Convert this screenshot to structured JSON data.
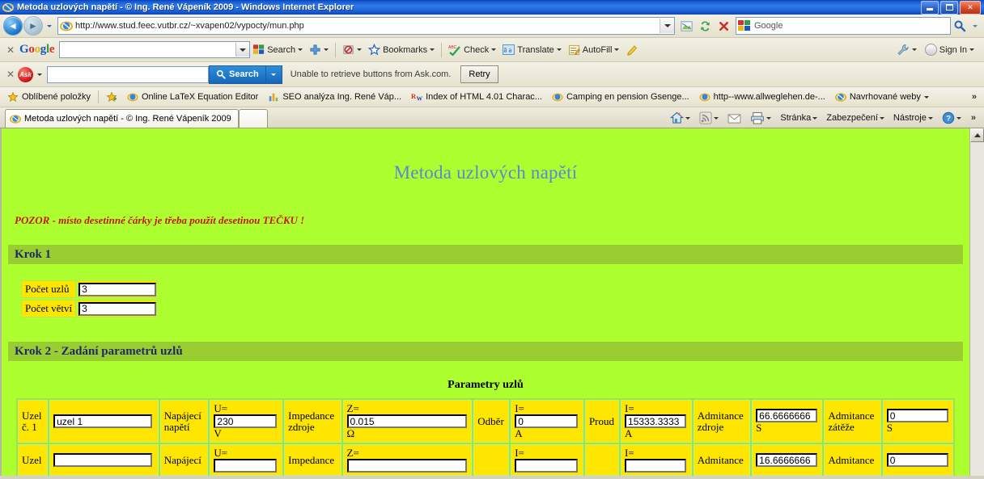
{
  "window": {
    "title": "Metoda uzlových napětí - © Ing. René Vápeník 2009 - Windows Internet Explorer",
    "minimize_label": "Minimize",
    "maximize_label": "Maximize",
    "close_label": "✕"
  },
  "navbar": {
    "back_glyph": "◄",
    "forward_glyph": "►",
    "url": "http://www.stud.feec.vutbr.cz/~xvapen02/vypocty/mun.php",
    "search_placeholder": "Google",
    "search_value": ""
  },
  "google_toolbar": {
    "close_x": "✕",
    "logo": [
      "G",
      "o",
      "o",
      "g",
      "l",
      "e"
    ],
    "input_value": "",
    "items": [
      {
        "label": "Search",
        "icon": "google-colors-icon",
        "caret": true
      },
      {
        "label": "",
        "icon": "plus-icon",
        "caret": true
      },
      {
        "label": "",
        "icon": "blocked-popup-icon",
        "caret": true
      },
      {
        "label": "Bookmarks",
        "icon": "star-icon",
        "caret": true
      },
      {
        "label": "Check",
        "icon": "spellcheck-icon",
        "caret": true
      },
      {
        "label": "Translate",
        "icon": "translate-icon",
        "caret": true
      },
      {
        "label": "AutoFill",
        "icon": "autofill-icon",
        "caret": true
      },
      {
        "label": "",
        "icon": "highlighter-icon",
        "caret": false
      }
    ],
    "right": [
      {
        "label": "",
        "icon": "wrench-icon",
        "caret": true
      },
      {
        "label": "Sign In",
        "icon": "user-circle-icon",
        "caret": true
      }
    ]
  },
  "ask_toolbar": {
    "close_x": "✕",
    "logo": "Ask",
    "input_value": "",
    "search_label": "Search",
    "message": "Unable to retrieve buttons from Ask.com.",
    "retry_label": "Retry"
  },
  "favorites": {
    "root_label": "Oblíbené položky",
    "items": [
      {
        "label": "Online LaTeX Equation Editor",
        "icon": "ie-page-icon"
      },
      {
        "label": "SEO analýza Ing. René Váp...",
        "icon": "chart-icon"
      },
      {
        "label": "Index of HTML 4.01 Charac...",
        "icon": "rw-icon"
      },
      {
        "label": "Camping en pension Gsenge...",
        "icon": "ie-page-icon"
      },
      {
        "label": "http--www.allweglehen.de-...",
        "icon": "ie-page-icon"
      },
      {
        "label": "Navrhované weby",
        "icon": "ie-logo-icon",
        "caret": true
      }
    ],
    "overflow": "»"
  },
  "tabs": {
    "open": [
      {
        "label": "Metoda uzlových napětí - © Ing. René Vápeník 2009",
        "icon": "ie-logo-icon",
        "active": true
      }
    ],
    "new_tab_label": "",
    "commands": [
      {
        "label": "",
        "icon": "home-icon",
        "caret": true
      },
      {
        "label": "",
        "icon": "rss-icon",
        "caret": true
      },
      {
        "label": "",
        "icon": "mail-icon",
        "caret": false
      },
      {
        "label": "",
        "icon": "print-icon",
        "caret": true
      },
      {
        "label": "Stránka",
        "icon": "",
        "caret": true
      },
      {
        "label": "Zabezpečení",
        "icon": "",
        "caret": true
      },
      {
        "label": "Nástroje",
        "icon": "",
        "caret": true
      },
      {
        "label": "",
        "icon": "help-icon",
        "caret": true
      }
    ],
    "overflow": "»"
  },
  "page": {
    "title": "Metoda uzlových napětí",
    "warning": "POZOR - místo desetinné čárky je třeba použít desetinou TEČKU !",
    "step1": {
      "heading": "Krok 1",
      "fields": [
        {
          "label": "Počet uzlů",
          "value": "3"
        },
        {
          "label": "Počet větví",
          "value": "3"
        }
      ]
    },
    "step2": {
      "heading": "Krok 2 - Zadání parametrů uzlů",
      "table_caption": "Parametry uzlů",
      "rows": [
        {
          "node_label": "Uzel\nč. 1",
          "name_value": "uzel 1",
          "supply_label": "Napájecí napětí",
          "u_prefix": "U=",
          "u_value": "230",
          "u_unit": "V",
          "impedance_label": "Impedance zdroje",
          "z_prefix": "Z=",
          "z_value": "0.015",
          "z_unit": "Ω",
          "draw_label": "Odběr",
          "i_prefix": "I=",
          "i_value": "0",
          "i_unit": "A",
          "current_label": "Proud",
          "i2_prefix": "I=",
          "i2_value": "15333.3333",
          "i2_unit": "A",
          "adm_src_label": "Admitance zdroje",
          "adm_src_value": "66.6666666",
          "adm_src_unit": "S",
          "adm_load_label": "Admitance zátěže",
          "adm_load_value": "0",
          "adm_load_unit": "S"
        },
        {
          "node_label": "Uzel",
          "name_value": "",
          "supply_label": "Napájecí",
          "u_prefix": "U=",
          "u_value": "",
          "u_unit": "",
          "impedance_label": "Impedance",
          "z_prefix": "Z=",
          "z_value": "",
          "z_unit": "",
          "draw_label": "",
          "i_prefix": "I=",
          "i_value": "",
          "i_unit": "",
          "current_label": "",
          "i2_prefix": "I=",
          "i2_value": "",
          "i2_unit": "",
          "adm_src_label": "Admitance",
          "adm_src_value": "16.6666666",
          "adm_src_unit": "",
          "adm_load_label": "Admitance",
          "adm_load_value": "0",
          "adm_load_unit": ""
        }
      ]
    }
  },
  "colors": {
    "page_bg": "#ADFF2F",
    "band_bg": "#9ACD32",
    "cell_bg": "#FFE600",
    "title_blue": "#5B86D6",
    "heading_navy": "#1B2A6B",
    "warning_red": "#C41818"
  },
  "scrollbar": {
    "up_arrow": "▲"
  }
}
